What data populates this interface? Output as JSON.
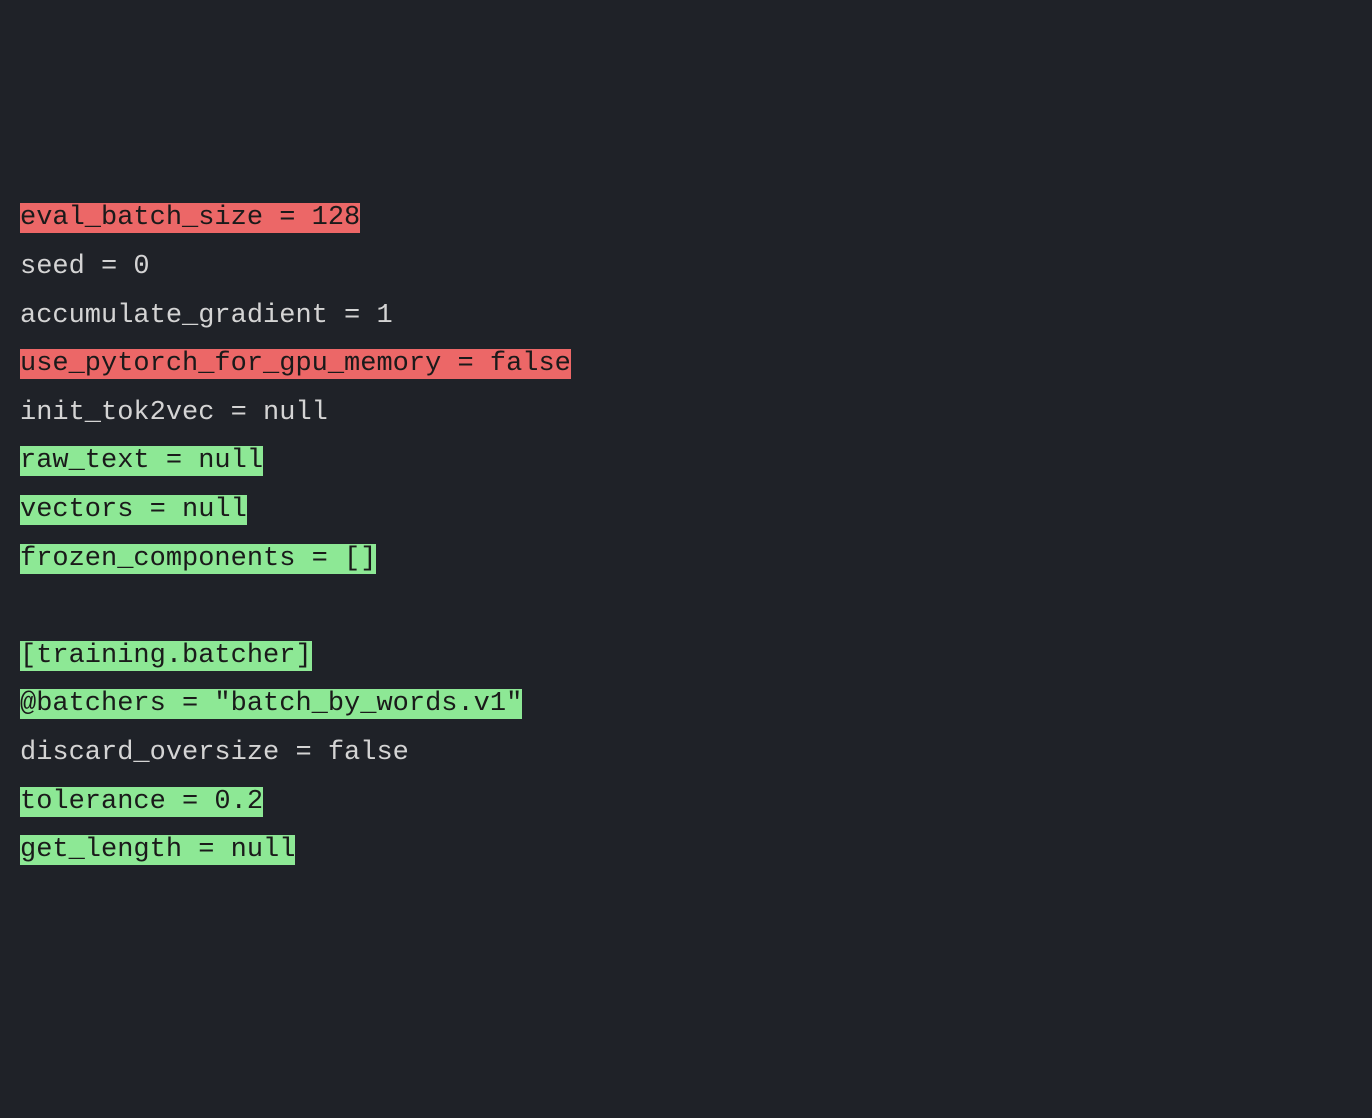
{
  "code": {
    "lines": [
      {
        "segments": [
          {
            "text": "eval_batch_size = 128",
            "style": "hl-red"
          }
        ]
      },
      {
        "segments": [
          {
            "text": "seed = 0",
            "style": "plain"
          }
        ]
      },
      {
        "segments": [
          {
            "text": "accumulate_gradient = 1",
            "style": "plain"
          }
        ]
      },
      {
        "segments": [
          {
            "text": "use_pytorch_for_gpu_memory = false",
            "style": "hl-red"
          }
        ]
      },
      {
        "segments": [
          {
            "text": "init_tok2vec = null",
            "style": "plain"
          }
        ]
      },
      {
        "segments": [
          {
            "text": "raw_text = null",
            "style": "hl-green"
          }
        ]
      },
      {
        "segments": [
          {
            "text": "vectors = null",
            "style": "hl-green"
          }
        ]
      },
      {
        "segments": [
          {
            "text": "frozen_components = []",
            "style": "hl-green"
          }
        ]
      },
      {
        "segments": [
          {
            "text": "",
            "style": "plain"
          }
        ]
      },
      {
        "segments": [
          {
            "text": "[training.batcher]",
            "style": "hl-green"
          }
        ]
      },
      {
        "segments": [
          {
            "text": "@batchers = \"batch_by_words.v1\"",
            "style": "hl-green"
          }
        ]
      },
      {
        "segments": [
          {
            "text": "discard_oversize = false",
            "style": "plain"
          }
        ]
      },
      {
        "segments": [
          {
            "text": "tolerance = 0.2",
            "style": "hl-green"
          }
        ]
      },
      {
        "segments": [
          {
            "text": "get_length = null",
            "style": "hl-green"
          }
        ]
      }
    ]
  }
}
